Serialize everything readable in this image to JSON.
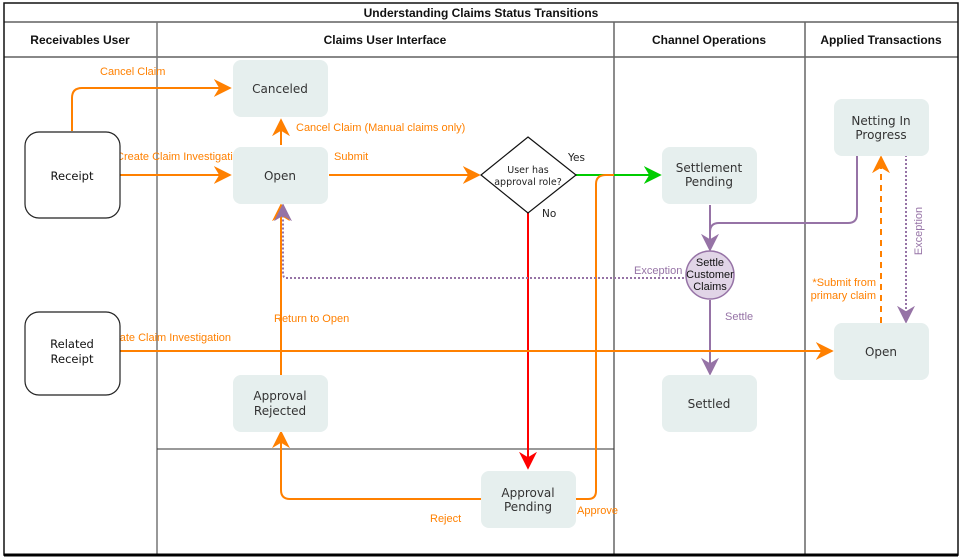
{
  "diagram": {
    "title": "Understanding Claims Status Transitions",
    "lanes": [
      {
        "id": "receivables",
        "label": "Receivables User"
      },
      {
        "id": "claims-ui",
        "label": "Claims User Interface"
      },
      {
        "id": "channel-ops",
        "label": "Channel Operations"
      },
      {
        "id": "applied-tx",
        "label": "Applied Transactions"
      }
    ],
    "actors": {
      "receipt": "Receipt",
      "related_receipt_line1": "Related",
      "related_receipt_line2": "Receipt"
    },
    "states": {
      "canceled": "Canceled",
      "open": "Open",
      "approval_rejected_line1": "Approval",
      "approval_rejected_line2": "Rejected",
      "approval_pending_line1": "Approval",
      "approval_pending_line2": "Pending",
      "settlement_pending_line1": "Settlement",
      "settlement_pending_line2": "Pending",
      "settled": "Settled",
      "netting_line1": "Netting In",
      "netting_line2": "Progress",
      "applied_open": "Open"
    },
    "decision": {
      "line1": "User has",
      "line2": "approval role?",
      "yes": "Yes",
      "no": "No"
    },
    "process": {
      "line1": "Settle",
      "line2": "Customer",
      "line3": "Claims"
    },
    "transitions": {
      "cancel_claim": "Cancel Claim",
      "cancel_manual": "Cancel Claim (Manual claims only)",
      "create_investigation": "Create Claim Investigation",
      "submit": "Submit",
      "create_investigation_related": "Create Claim Investigation",
      "return_to_open": "Return to Open",
      "reject": "Reject",
      "approve": "Approve",
      "exception_channel": "Exception",
      "settle": "Settle",
      "submit_primary_line1": "*Submit from",
      "submit_primary_line2": "primary claim",
      "exception_applied": "Exception"
    },
    "colors": {
      "orange": "#ff8000",
      "purple": "#9673a6",
      "green": "#00cc00",
      "red": "#ff0000",
      "state_fill": "#e6efee",
      "process_fill": "#e1d5e7"
    }
  }
}
